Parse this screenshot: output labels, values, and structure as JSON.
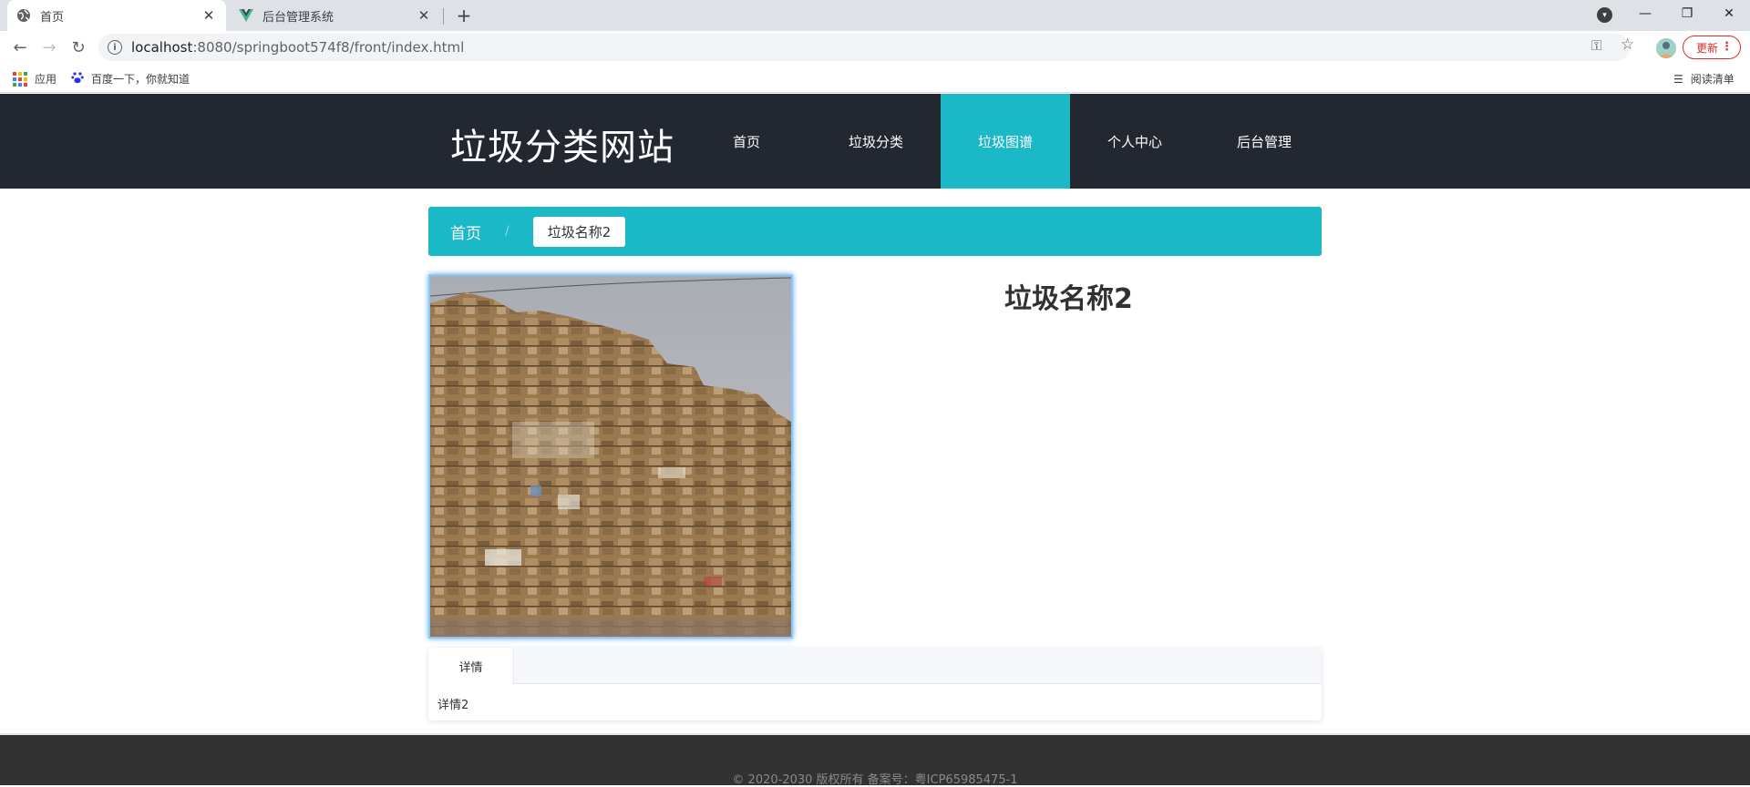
{
  "browser": {
    "tabs": [
      {
        "title": "首页",
        "active": true
      },
      {
        "title": "后台管理系统",
        "active": false
      }
    ],
    "url_host": "localhost",
    "url_path": ":8080/springboot574f8/front/index.html",
    "update_label": "更新",
    "bookmarks": [
      {
        "label": "应用",
        "icon": "apps-grid-icon"
      },
      {
        "label": "百度一下，你就知道",
        "icon": "baidu-paw-icon"
      }
    ],
    "reading_list_label": "阅读清单"
  },
  "site": {
    "title": "垃圾分类网站",
    "nav": [
      {
        "label": "首页",
        "active": false
      },
      {
        "label": "垃圾分类",
        "active": false
      },
      {
        "label": "垃圾图谱",
        "active": true
      },
      {
        "label": "个人中心",
        "active": false
      },
      {
        "label": "后台管理",
        "active": false
      }
    ],
    "breadcrumb": {
      "home": "首页",
      "separator": "/",
      "current": "垃圾名称2"
    },
    "item": {
      "name": "垃圾名称2",
      "image_alt": "baled cardboard waste",
      "tab_label": "详情",
      "detail": "详情2"
    },
    "footer": "© 2020-2030 版权所有 备案号：粤ICP65985475-1"
  },
  "colors": {
    "accent": "#1bb8c8",
    "header_bg": "#232830",
    "footer_bg": "#323232"
  }
}
